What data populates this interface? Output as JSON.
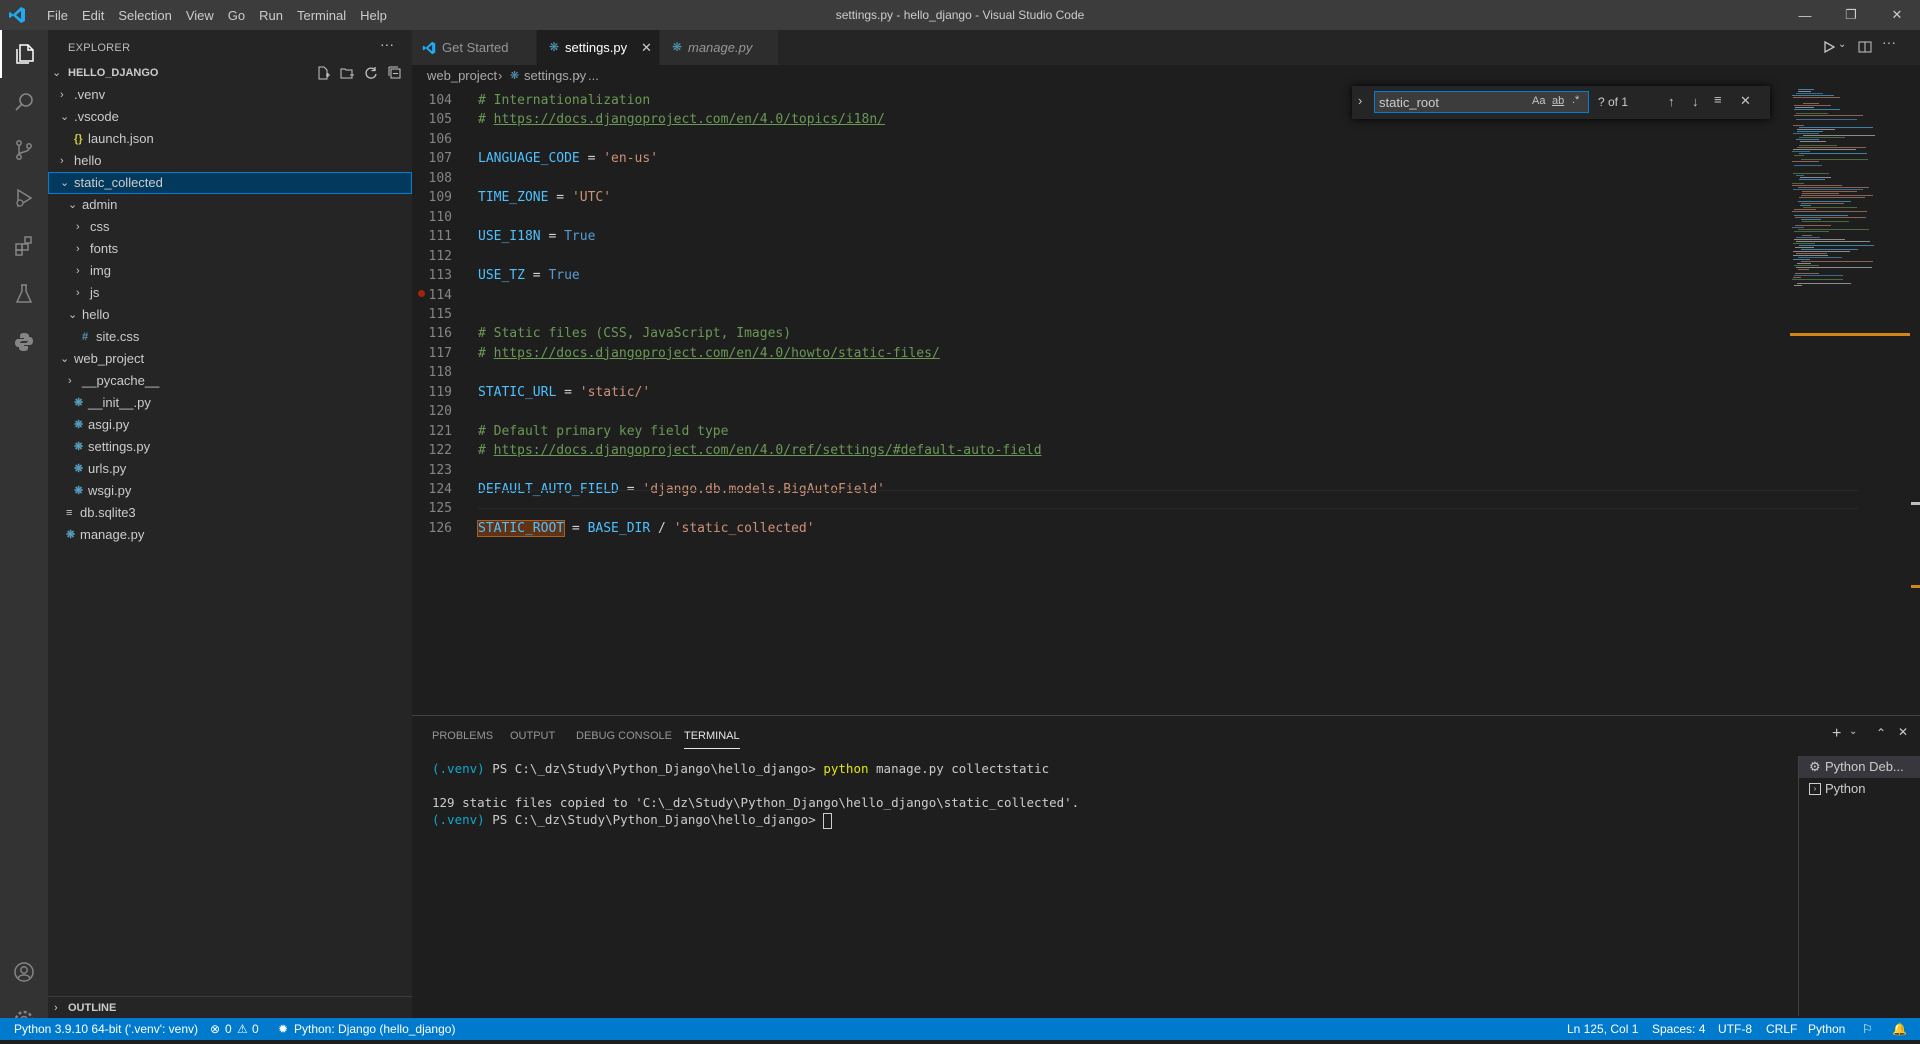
{
  "titlebar": {
    "menu": [
      "File",
      "Edit",
      "Selection",
      "View",
      "Go",
      "Run",
      "Terminal",
      "Help"
    ],
    "title": "settings.py - hello_django - Visual Studio Code"
  },
  "sidebar": {
    "header": "EXPLORER",
    "root": "HELLO_DJANGO",
    "tree": [
      {
        "label": ".venv",
        "kind": "folder",
        "depth": 1,
        "open": false
      },
      {
        "label": ".vscode",
        "kind": "folder",
        "depth": 1,
        "open": true
      },
      {
        "label": "launch.json",
        "kind": "json",
        "depth": 2
      },
      {
        "label": "hello",
        "kind": "folder",
        "depth": 1,
        "open": false
      },
      {
        "label": "static_collected",
        "kind": "folder",
        "depth": 1,
        "open": true,
        "selected": true
      },
      {
        "label": "admin",
        "kind": "folder",
        "depth": 2,
        "open": true
      },
      {
        "label": "css",
        "kind": "folder",
        "depth": 3,
        "open": false
      },
      {
        "label": "fonts",
        "kind": "folder",
        "depth": 3,
        "open": false
      },
      {
        "label": "img",
        "kind": "folder",
        "depth": 3,
        "open": false
      },
      {
        "label": "js",
        "kind": "folder",
        "depth": 3,
        "open": false
      },
      {
        "label": "hello",
        "kind": "folder",
        "depth": 2,
        "open": true
      },
      {
        "label": "site.css",
        "kind": "css",
        "depth": 3
      },
      {
        "label": "web_project",
        "kind": "folder",
        "depth": 1,
        "open": true
      },
      {
        "label": "__pycache__",
        "kind": "folder",
        "depth": 2,
        "open": false
      },
      {
        "label": "__init__.py",
        "kind": "py",
        "depth": 2
      },
      {
        "label": "asgi.py",
        "kind": "py",
        "depth": 2
      },
      {
        "label": "settings.py",
        "kind": "py",
        "depth": 2
      },
      {
        "label": "urls.py",
        "kind": "py",
        "depth": 2
      },
      {
        "label": "wsgi.py",
        "kind": "py",
        "depth": 2
      },
      {
        "label": "db.sqlite3",
        "kind": "db",
        "depth": 1
      },
      {
        "label": "manage.py",
        "kind": "py",
        "depth": 1
      }
    ],
    "outline": "OUTLINE"
  },
  "tabs": [
    {
      "label": "Get Started"
    },
    {
      "label": "settings.py",
      "active": true
    },
    {
      "label": "manage.py",
      "italic": true
    }
  ],
  "breadcrumb": {
    "folder": "web_project",
    "file": "settings.py",
    "rest": "..."
  },
  "editor": {
    "lines": [
      {
        "n": "104",
        "html": "<span class='c-com'># Internationalization</span>"
      },
      {
        "n": "105",
        "html": "<span class='c-com'># </span><span class='c-link'>https://docs.djangoproject.com/en/4.0/topics/i18n/</span>"
      },
      {
        "n": "106",
        "html": ""
      },
      {
        "n": "107",
        "html": "<span class='c-var'>LANGUAGE_CODE</span> = <span class='c-str'>'en-us'</span>"
      },
      {
        "n": "108",
        "html": ""
      },
      {
        "n": "109",
        "html": "<span class='c-var'>TIME_ZONE</span> = <span class='c-str'>'UTC'</span>"
      },
      {
        "n": "110",
        "html": ""
      },
      {
        "n": "111",
        "html": "<span class='c-var'>USE_I18N</span> = <span class='c-kw'>True</span>"
      },
      {
        "n": "112",
        "html": ""
      },
      {
        "n": "113",
        "html": "<span class='c-var'>USE_TZ</span> = <span class='c-kw'>True</span>"
      },
      {
        "n": "114",
        "html": ""
      },
      {
        "n": "115",
        "html": ""
      },
      {
        "n": "116",
        "html": "<span class='c-com'># Static files (CSS, JavaScript, Images)</span>"
      },
      {
        "n": "117",
        "html": "<span class='c-com'># </span><span class='c-link'>https://docs.djangoproject.com/en/4.0/howto/static-files/</span>"
      },
      {
        "n": "118",
        "html": ""
      },
      {
        "n": "119",
        "html": "<span class='c-var'>STATIC_URL</span> = <span class='c-str'>'static/'</span>"
      },
      {
        "n": "120",
        "html": ""
      },
      {
        "n": "121",
        "html": "<span class='c-com'># Default primary key field type</span>"
      },
      {
        "n": "122",
        "html": "<span class='c-com'># </span><span class='c-link'>https://docs.djangoproject.com/en/4.0/ref/settings/#default-auto-field</span>"
      },
      {
        "n": "123",
        "html": ""
      },
      {
        "n": "124",
        "html": "<span class='c-var'>DEFAULT_AUTO_FIELD</span> = <span class='c-str'>'django.db.models.BigAutoField'</span>"
      },
      {
        "n": "125",
        "html": ""
      },
      {
        "n": "126",
        "html": "<span class='c-var hl'>STATIC_ROOT</span> = <span class='c-var'>BASE_DIR</span> / <span class='c-str'>'static_collected'</span>"
      }
    ]
  },
  "find": {
    "value": "static_root",
    "case_label": "Aa",
    "word_label": "ab",
    "regex_label": ".*",
    "count": "? of 1"
  },
  "panel": {
    "tabs": [
      "PROBLEMS",
      "OUTPUT",
      "DEBUG CONSOLE",
      "TERMINAL"
    ],
    "terminal_lines": [
      {
        "env": "(.venv)",
        "prompt": " PS C:\\_dz\\Study\\Python_Django\\hello_django> ",
        "cmd": "python",
        "args": " manage.py collectstatic"
      },
      {
        "text": ""
      },
      {
        "text": "129 static files copied to 'C:\\_dz\\Study\\Python_Django\\hello_django\\static_collected'."
      },
      {
        "env": "(.venv)",
        "prompt": " PS C:\\_dz\\Study\\Python_Django\\hello_django> ",
        "cursor": true
      }
    ],
    "terminal_list": [
      "Python Deb...",
      "Python"
    ]
  },
  "status": {
    "interpreter": "Python 3.9.10 64-bit ('.venv': venv)",
    "errors": "0",
    "warnings": "0",
    "debug": "Python: Django (hello_django)",
    "position": "Ln 125, Col 1",
    "spaces": "Spaces: 4",
    "encoding": "UTF-8",
    "eol": "CRLF",
    "language": "Python"
  },
  "colors": {
    "accent": "#007acc",
    "selection": "#04395e",
    "python_icon": "#519aba",
    "json_icon": "#cbcb41",
    "css_icon": "#519aba"
  }
}
